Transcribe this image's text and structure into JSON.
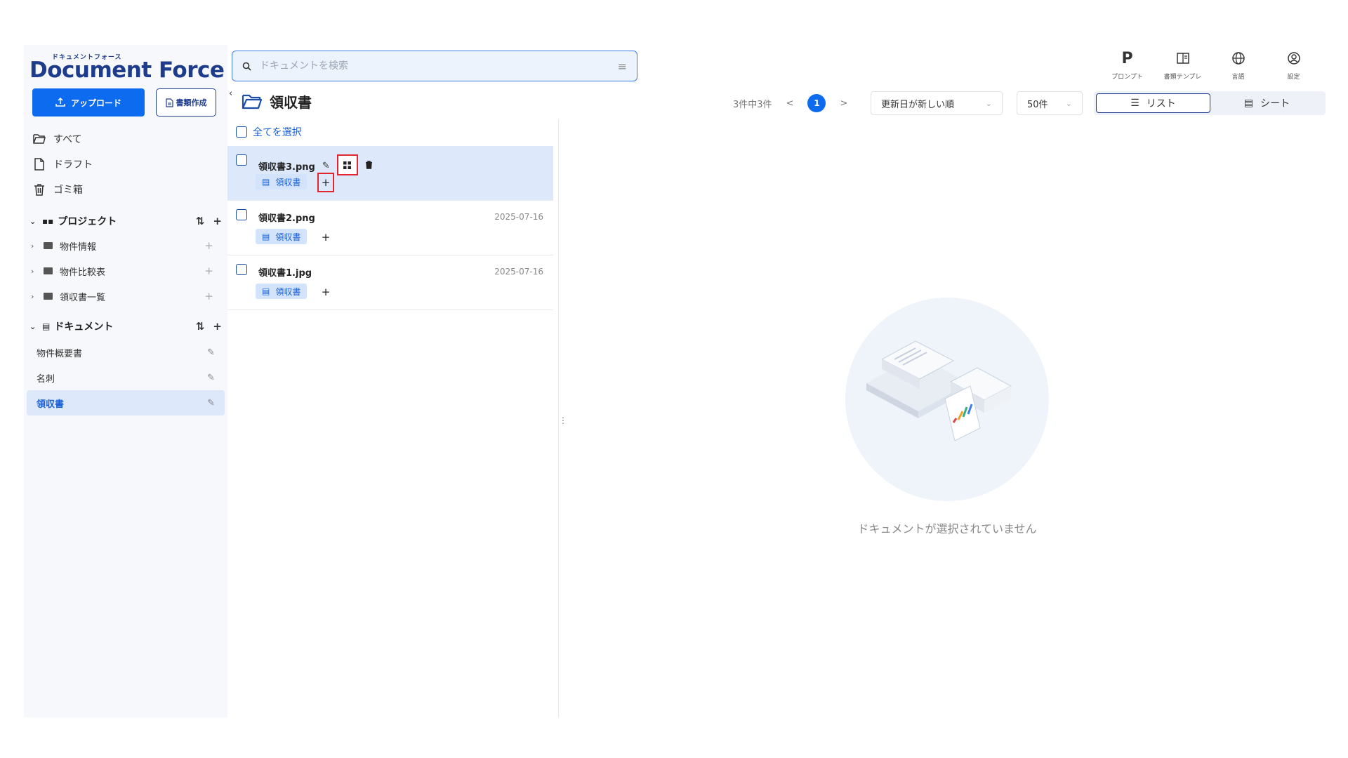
{
  "app": {
    "logo_kana": "ドキュメントフォース",
    "logo_text": "Document Force"
  },
  "sidebar": {
    "upload_label": "アップロード",
    "create_label": "書類作成",
    "nav": [
      {
        "label": "すべて",
        "icon": "folder-open-icon"
      },
      {
        "label": "ドラフト",
        "icon": "file-icon"
      },
      {
        "label": "ゴミ箱",
        "icon": "trash-icon"
      }
    ],
    "projects_title": "プロジェクト",
    "projects": [
      {
        "label": "物件情報"
      },
      {
        "label": "物件比較表"
      },
      {
        "label": "領収書一覧"
      }
    ],
    "documents_title": "ドキュメント",
    "documents": [
      {
        "label": "物件概要書",
        "active": false
      },
      {
        "label": "名刺",
        "active": false
      },
      {
        "label": "領収書",
        "active": true
      }
    ]
  },
  "search": {
    "placeholder": "ドキュメントを検索"
  },
  "toolbar": {
    "items": [
      {
        "label": "プロンプト",
        "icon": "p-icon"
      },
      {
        "label": "書類テンプレ",
        "icon": "template-icon"
      },
      {
        "label": "言語",
        "icon": "globe-icon"
      },
      {
        "label": "設定",
        "icon": "user-settings-icon"
      }
    ]
  },
  "list_header": {
    "folder_title": "領収書",
    "count_text": "3件中3件",
    "prev": "<",
    "current_page": "1",
    "next": ">",
    "sort_value": "更新日が新しい順",
    "per_page_value": "50件",
    "view_list_label": "リスト",
    "view_sheet_label": "シート"
  },
  "list": {
    "select_all_label": "全てを選択",
    "rows": [
      {
        "name": "領収書3.png",
        "date": "",
        "tag": "領収書",
        "add": "+",
        "active": true
      },
      {
        "name": "領収書2.png",
        "date": "2025-07-16",
        "tag": "領収書",
        "add": "+",
        "active": false
      },
      {
        "name": "領収書1.jpg",
        "date": "2025-07-16",
        "tag": "領収書",
        "add": "+",
        "active": false
      }
    ]
  },
  "preview": {
    "empty_text": "ドキュメントが選択されていません"
  },
  "colors": {
    "primary": "#0d6bf0",
    "brand": "#1d3c8c",
    "active_bg": "#dde8fb",
    "highlight": "#e0262f"
  }
}
